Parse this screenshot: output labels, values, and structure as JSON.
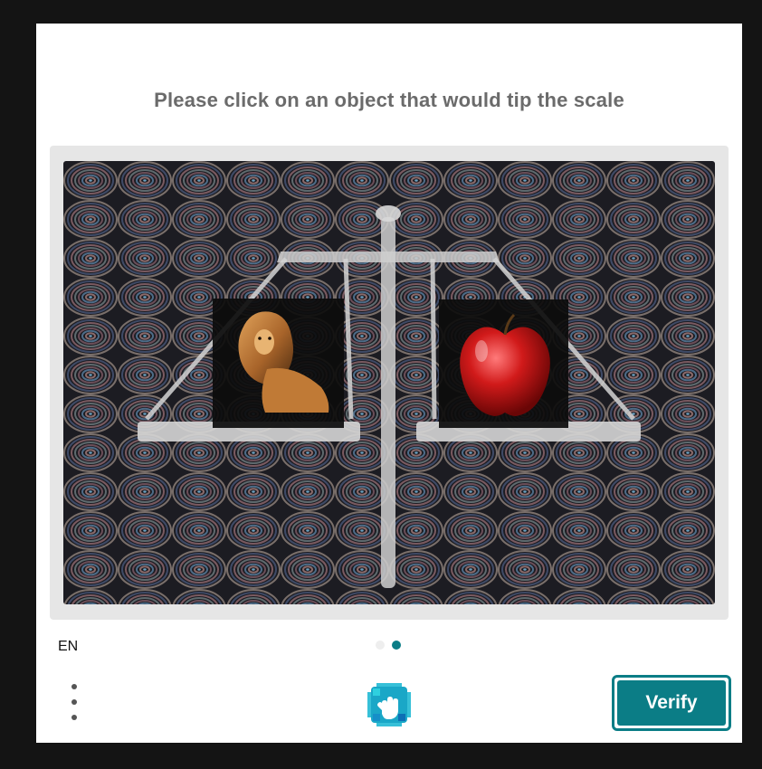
{
  "challenge": {
    "prompt": "Please click on an object that would tip the scale",
    "image_subject": "balance scale with a lion on the left pan and an apple on the right pan over a concentric-circle pattern",
    "objects": [
      "lion",
      "apple"
    ]
  },
  "footer": {
    "language": "EN",
    "page_dots": [
      {
        "active": false
      },
      {
        "active": true
      }
    ],
    "verify_label": "Verify"
  },
  "colors": {
    "accent": "#0b7d86",
    "prompt_text": "#6b6b6b",
    "backdrop": "#141414"
  },
  "icons": {
    "menu": "vertical-dots-icon",
    "logo": "hand-logo-icon"
  }
}
